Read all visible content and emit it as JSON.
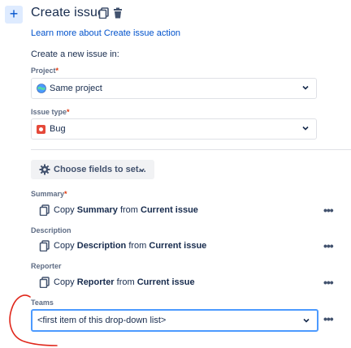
{
  "header": {
    "add_icon": "plus-icon",
    "title": "Create issue",
    "learn_link": "Learn more about Create issue action"
  },
  "intro": {
    "label": "Create a new issue in:"
  },
  "project": {
    "label": "Project",
    "required": "*",
    "value": "Same project",
    "icon": "project-globe-icon"
  },
  "issue_type": {
    "label": "Issue type",
    "required": "*",
    "value": "Bug",
    "icon": "bug-icon"
  },
  "choose_fields": {
    "label": "Choose fields to set..."
  },
  "fields": [
    {
      "label": "Summary",
      "required": "*",
      "pre": "Copy ",
      "field": "Summary",
      "mid": " from ",
      "source": "Current issue"
    },
    {
      "label": "Description",
      "required": "",
      "pre": "Copy ",
      "field": "Description",
      "mid": " from ",
      "source": "Current issue"
    },
    {
      "label": "Reporter",
      "required": "",
      "pre": "Copy ",
      "field": "Reporter",
      "mid": " from ",
      "source": "Current issue"
    }
  ],
  "teams": {
    "label": "Teams",
    "value": "<first item of this drop-down list>"
  },
  "more_label": "•••",
  "colors": {
    "accent": "#0052cc",
    "focus_border": "#4c9aff",
    "annotation": "#e0261a",
    "bug_red": "#e5493a"
  }
}
